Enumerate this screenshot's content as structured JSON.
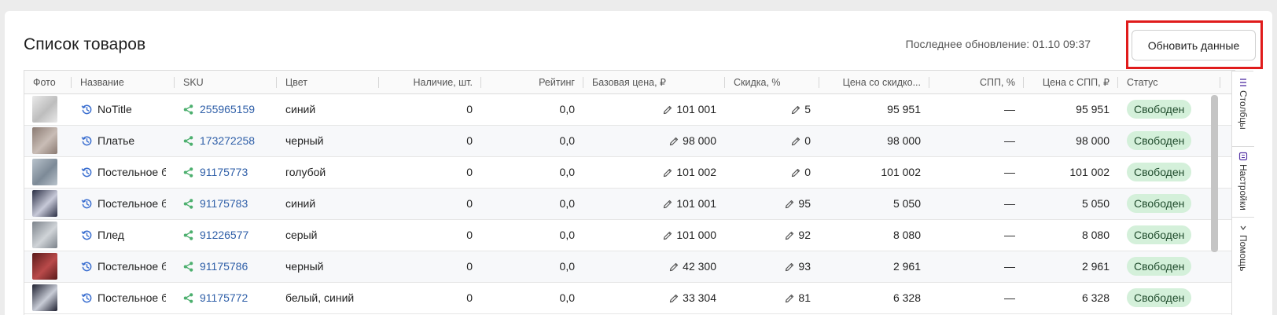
{
  "header": {
    "title": "Список товаров",
    "last_update": "Последнее обновление: 01.10 09:37",
    "refresh_label": "Обновить данные"
  },
  "table": {
    "columns": [
      "Фото",
      "Название",
      "SKU",
      "Цвет",
      "Наличие, шт.",
      "Рейтинг",
      "Базовая цена, ₽",
      "Скидка, %",
      "Цена со скидко...",
      "СПП, %",
      "Цена с СПП, ₽",
      "Статус"
    ],
    "rows": [
      {
        "name": "NoTitle",
        "sku": "255965159",
        "color": "синий",
        "stock": "0",
        "rating": "0,0",
        "base_price": "101 001",
        "discount": "5",
        "discount_price": "95 951",
        "spp": "—",
        "spp_price": "95 951",
        "status": "Свободен"
      },
      {
        "name": "Платье",
        "sku": "173272258",
        "color": "черный",
        "stock": "0",
        "rating": "0,0",
        "base_price": "98 000",
        "discount": "0",
        "discount_price": "98 000",
        "spp": "—",
        "spp_price": "98 000",
        "status": "Свободен"
      },
      {
        "name": "Постельное бел",
        "sku": "91175773",
        "color": "голубой",
        "stock": "0",
        "rating": "0,0",
        "base_price": "101 002",
        "discount": "0",
        "discount_price": "101 002",
        "spp": "—",
        "spp_price": "101 002",
        "status": "Свободен"
      },
      {
        "name": "Постельное бел",
        "sku": "91175783",
        "color": "синий",
        "stock": "0",
        "rating": "0,0",
        "base_price": "101 001",
        "discount": "95",
        "discount_price": "5 050",
        "spp": "—",
        "spp_price": "5 050",
        "status": "Свободен"
      },
      {
        "name": "Плед",
        "sku": "91226577",
        "color": "серый",
        "stock": "0",
        "rating": "0,0",
        "base_price": "101 000",
        "discount": "92",
        "discount_price": "8 080",
        "spp": "—",
        "spp_price": "8 080",
        "status": "Свободен"
      },
      {
        "name": "Постельное бел",
        "sku": "91175786",
        "color": "черный",
        "stock": "0",
        "rating": "0,0",
        "base_price": "42 300",
        "discount": "93",
        "discount_price": "2 961",
        "spp": "—",
        "spp_price": "2 961",
        "status": "Свободен"
      },
      {
        "name": "Постельное бел",
        "sku": "91175772",
        "color": "белый, синий",
        "stock": "0",
        "rating": "0,0",
        "base_price": "33 304",
        "discount": "81",
        "discount_price": "6 328",
        "spp": "—",
        "spp_price": "6 328",
        "status": "Свободен"
      }
    ]
  },
  "sidebar": {
    "columns_label": "Столбцы",
    "settings_label": "Настройки",
    "help_label": "Помощь"
  },
  "colors": {
    "accent_link": "#2f5fa8",
    "status_bg": "#d4f0da",
    "highlight": "#e01b1b",
    "share_icon": "#4caf6e",
    "history_icon": "#3b6fd0"
  },
  "icons": {
    "name_prefix": "history-icon",
    "sku_prefix": "share-icon",
    "edit": "pencil-icon"
  }
}
